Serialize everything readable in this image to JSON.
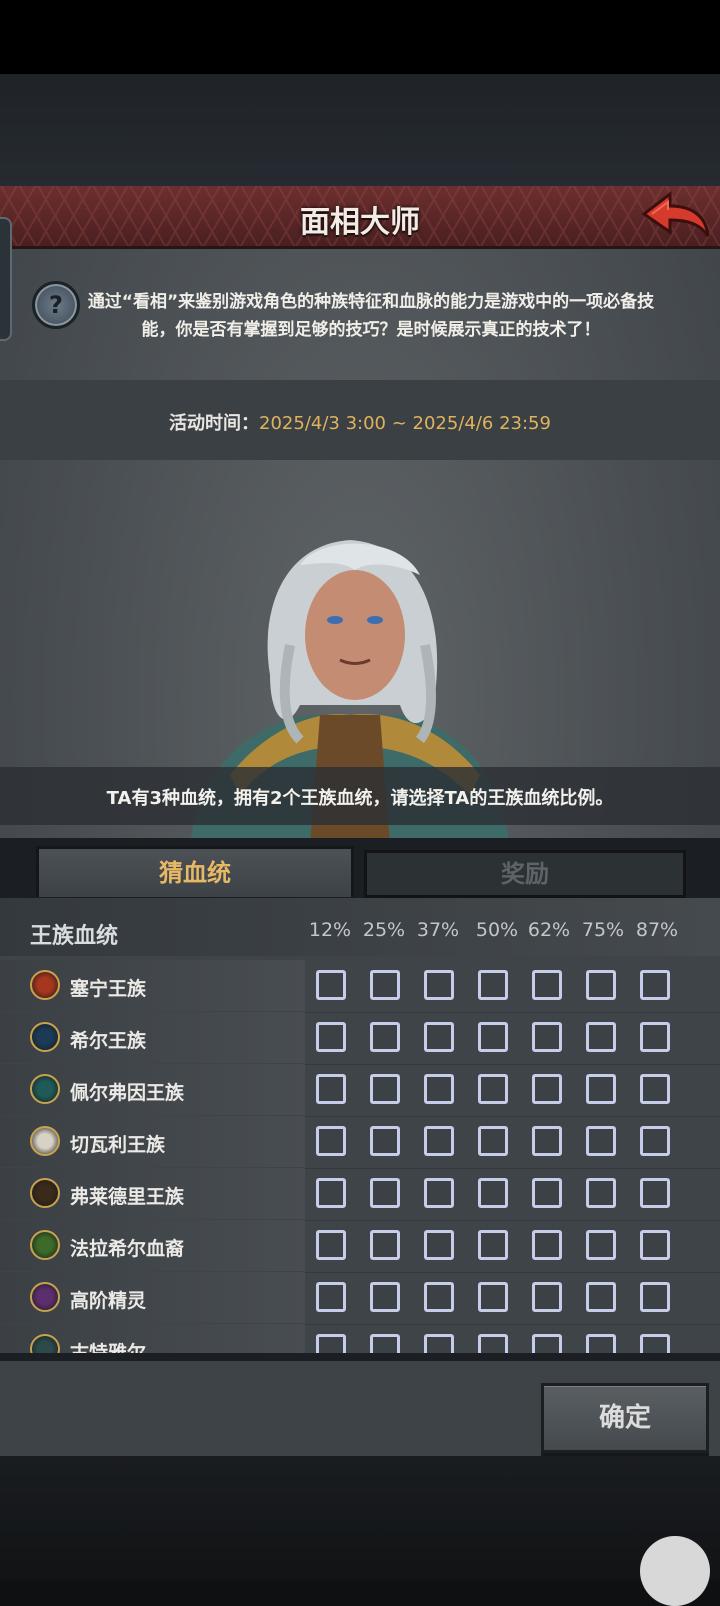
{
  "header": {
    "title": "面相大师"
  },
  "description": "通过“看相”来鉴别游戏角色的种族特征和血脉的能力是游戏中的一项必备技能，你是否有掌握到足够的技巧？是时候展示真正的技术了！",
  "event_time": {
    "label": "活动时间：",
    "value": "2025/4/3 3:00 ~ 2025/4/6 23:59"
  },
  "question": "TA有3种血统，拥有2个王族血统，请选择TA的王族血统比例。",
  "tabs": {
    "guess": "猜血统",
    "reward": "奖励",
    "active": "guess"
  },
  "table": {
    "header_label": "王族血统",
    "percentages": [
      "12%",
      "25%",
      "37%",
      "50%",
      "62%",
      "75%",
      "87%"
    ],
    "rows": [
      {
        "name": "塞宁王族",
        "icon": "sening-emblem-icon",
        "color": "#a5371f"
      },
      {
        "name": "希尔王族",
        "icon": "hill-emblem-icon",
        "color": "#1b3a55"
      },
      {
        "name": "佩尔弗因王族",
        "icon": "pelfoin-emblem-icon",
        "color": "#1f5a58"
      },
      {
        "name": "切瓦利王族",
        "icon": "chevalier-emblem-icon",
        "color": "#d7d2c4"
      },
      {
        "name": "弗莱德里王族",
        "icon": "fredley-emblem-icon",
        "color": "#3a2a1a"
      },
      {
        "name": "法拉希尔血裔",
        "icon": "farahill-emblem-icon",
        "color": "#3c6a2a"
      },
      {
        "name": "高阶精灵",
        "icon": "high-elf-emblem-icon",
        "color": "#5b2f6e"
      },
      {
        "name": "古特雅尔",
        "icon": "gutyar-emblem-icon",
        "color": "#2b4a48"
      }
    ]
  },
  "confirm_label": "确定"
}
